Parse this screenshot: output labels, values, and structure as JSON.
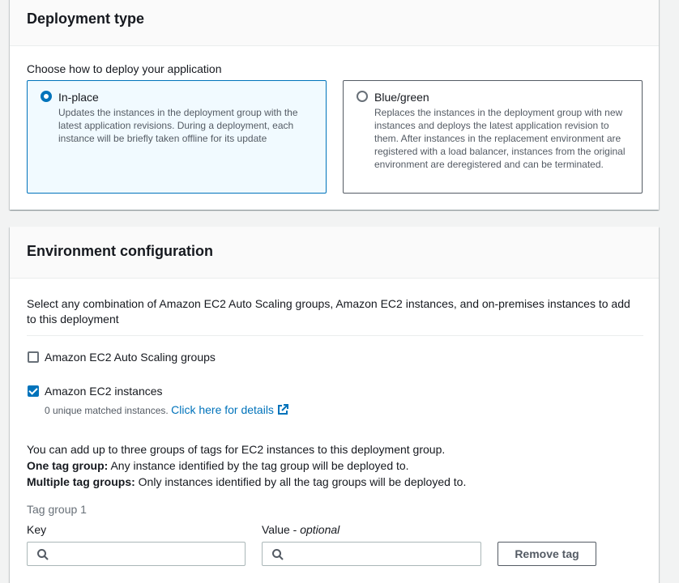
{
  "deployment_type": {
    "title": "Deployment type",
    "prompt": "Choose how to deploy your application",
    "options": [
      {
        "label": "In-place",
        "selected": true,
        "description": "Updates the instances in the deployment group with the latest application revisions. During a deployment, each instance will be briefly taken offline for its update"
      },
      {
        "label": "Blue/green",
        "selected": false,
        "description": "Replaces the instances in the deployment group with new instances and deploys the latest application revision to them. After instances in the replacement environment are registered with a load balancer, instances from the original environment are deregistered and can be terminated."
      }
    ]
  },
  "environment": {
    "title": "Environment configuration",
    "intro": "Select any combination of Amazon EC2 Auto Scaling groups, Amazon EC2 instances, and on-premises instances to add to this deployment",
    "asg": {
      "label": "Amazon EC2 Auto Scaling groups",
      "checked": false
    },
    "ec2": {
      "label": "Amazon EC2 instances",
      "checked": true,
      "matched": "0 unique matched instances.",
      "details_link": "Click here for details"
    },
    "info_line": "You can add up to three groups of tags for EC2 instances to this deployment group.",
    "one_tag_bold": "One tag group:",
    "one_tag_text": " Any instance identified by the tag group will be deployed to.",
    "multi_tag_bold": "Multiple tag groups:",
    "multi_tag_text": " Only instances identified by all the tag groups will be deployed to.",
    "tag_group": {
      "title": "Tag group 1",
      "key_label": "Key",
      "value_label": "Value - ",
      "value_optional": "optional",
      "key_value": "",
      "value_value": "",
      "remove_button": "Remove tag"
    }
  },
  "colors": {
    "accent": "#0073bb",
    "text": "#16191f",
    "muted": "#545b64"
  }
}
